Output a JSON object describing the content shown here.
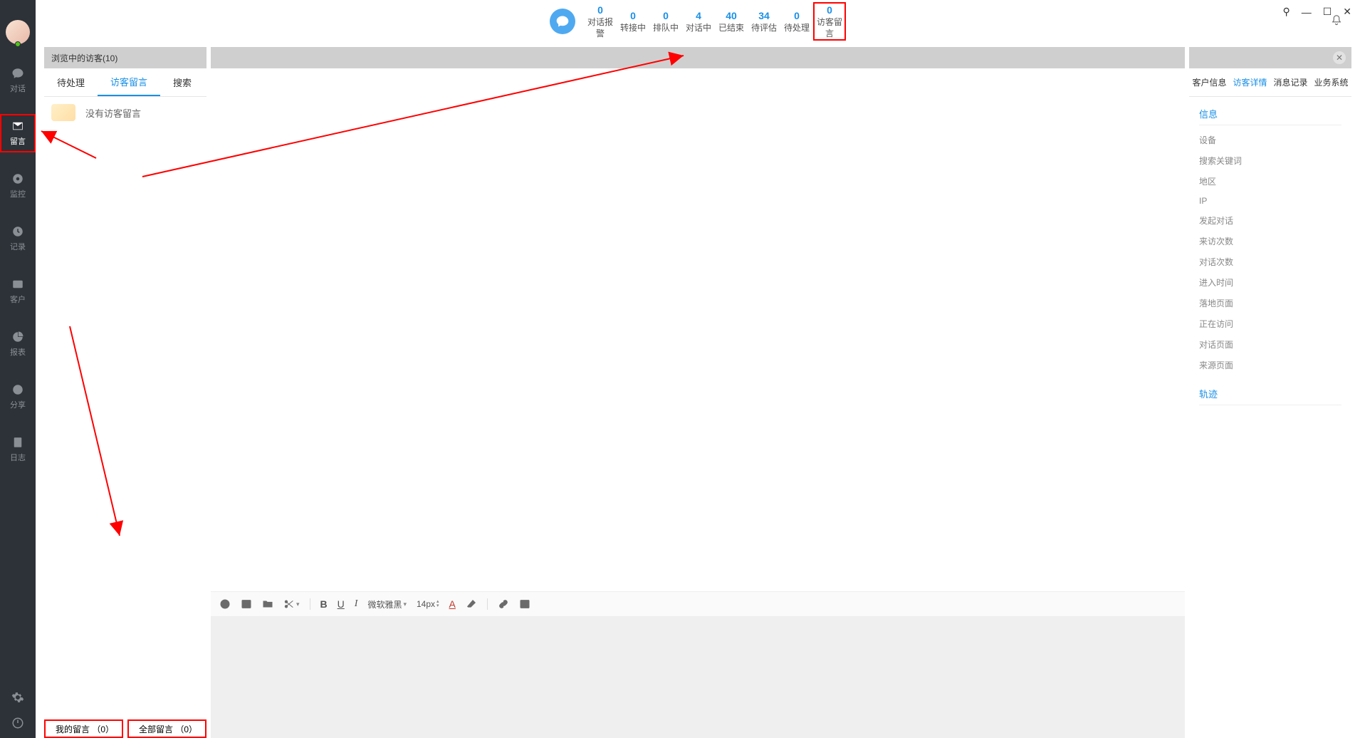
{
  "window": {
    "pin": "⚲",
    "minimize": "—",
    "maximize": "☐",
    "close": "✕"
  },
  "sidebar": {
    "items": [
      {
        "label": "对话",
        "icon": "chat"
      },
      {
        "label": "留言",
        "icon": "mail",
        "active": true
      },
      {
        "label": "监控",
        "icon": "eye"
      },
      {
        "label": "记录",
        "icon": "clock"
      },
      {
        "label": "客户",
        "icon": "id-card"
      },
      {
        "label": "报表",
        "icon": "pie"
      },
      {
        "label": "分享",
        "icon": "share"
      },
      {
        "label": "日志",
        "icon": "doc"
      }
    ]
  },
  "stats": [
    {
      "count": "0",
      "label": "对话报警"
    },
    {
      "count": "0",
      "label": "转接中"
    },
    {
      "count": "0",
      "label": "排队中"
    },
    {
      "count": "4",
      "label": "对话中"
    },
    {
      "count": "40",
      "label": "已结束"
    },
    {
      "count": "34",
      "label": "待评估"
    },
    {
      "count": "0",
      "label": "待处理"
    },
    {
      "count": "0",
      "label": "访客留言",
      "highlighted": true
    }
  ],
  "leftPanel": {
    "header": "浏览中的访客(10)",
    "tabs": [
      {
        "label": "待处理"
      },
      {
        "label": "访客留言",
        "active": true
      },
      {
        "label": "搜索"
      }
    ],
    "emptyText": "没有访客留言"
  },
  "bottomTabs": [
    {
      "label": "我的留言 （0）"
    },
    {
      "label": "全部留言 （0）"
    }
  ],
  "editor": {
    "fontName": "微软雅黑",
    "fontSize": "14px"
  },
  "rightPanel": {
    "tabs": [
      {
        "label": "客户信息"
      },
      {
        "label": "访客详情",
        "active": true
      },
      {
        "label": "消息记录"
      },
      {
        "label": "业务系统"
      }
    ],
    "sections": {
      "info": "信息",
      "fields": [
        "设备",
        "搜索关键词",
        "地区",
        "IP",
        "发起对话",
        "来访次数",
        "对话次数",
        "进入时间",
        "落地页面",
        "正在访问",
        "对话页面",
        "来源页面"
      ],
      "track": "轨迹"
    }
  }
}
